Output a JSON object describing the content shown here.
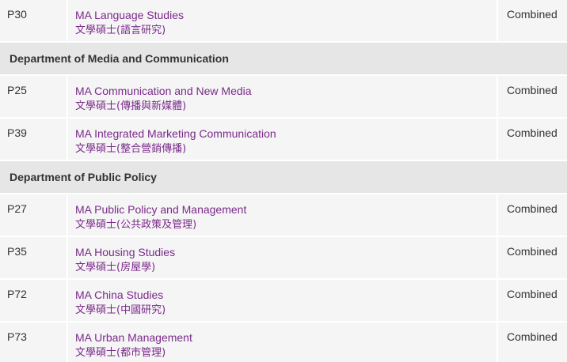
{
  "sections": [
    {
      "rows": [
        {
          "code": "P30",
          "name_en": "MA Language Studies",
          "name_zh": "文學碩士(語言研究)",
          "mode": "Combined"
        }
      ]
    },
    {
      "department": "Department of Media and Communication",
      "rows": [
        {
          "code": "P25",
          "name_en": "MA Communication and New Media",
          "name_zh": "文學碩士(傳播與新媒體)",
          "mode": "Combined"
        },
        {
          "code": "P39",
          "name_en": "MA Integrated Marketing Communication",
          "name_zh": "文學碩士(整合營銷傳播)",
          "mode": "Combined"
        }
      ]
    },
    {
      "department": "Department of Public Policy",
      "rows": [
        {
          "code": "P27",
          "name_en": "MA Public Policy and Management",
          "name_zh": "文學碩士(公共政策及管理)",
          "mode": "Combined"
        },
        {
          "code": "P35",
          "name_en": "MA Housing Studies",
          "name_zh": "文學碩士(房屋學)",
          "mode": "Combined"
        },
        {
          "code": "P72",
          "name_en": "MA China Studies",
          "name_zh": "文學碩士(中國研究)",
          "mode": "Combined"
        },
        {
          "code": "P73",
          "name_en": "MA Urban Management",
          "name_zh": "文學碩士(都市管理)",
          "mode": "Combined"
        }
      ]
    }
  ],
  "colors": {
    "link": "#7a2a8a",
    "row_bg": "#f5f5f5",
    "dept_bg": "#e6e6e6",
    "text": "#333333"
  }
}
